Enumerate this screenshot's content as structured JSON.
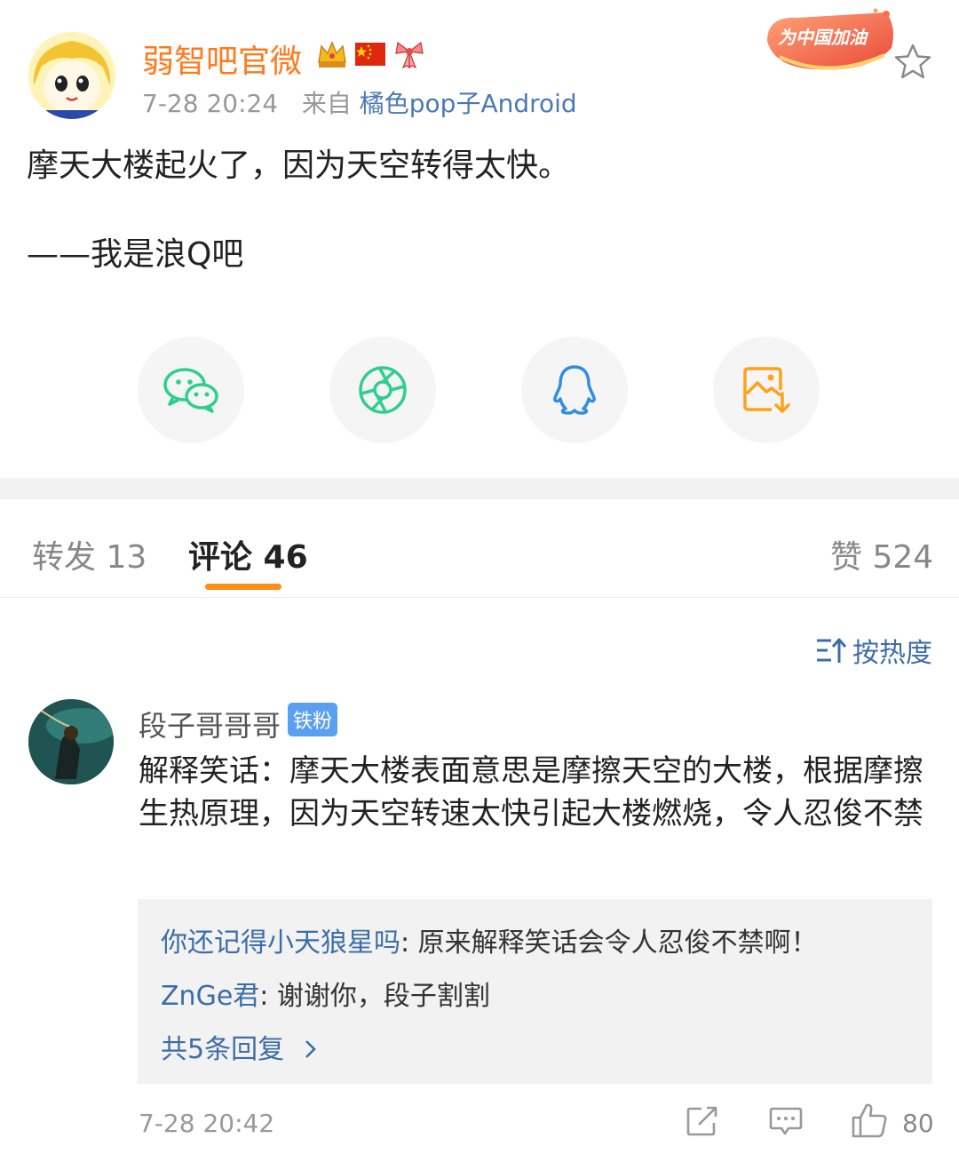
{
  "post": {
    "author": "弱智吧官微",
    "time": "7-28 20:24",
    "source_prefix": "来自",
    "source": "橘色pop子Android",
    "banner_text": "为中国加油",
    "text": "摩天大楼起火了，因为天空转得太快。\n\n——我是浪Q吧"
  },
  "share_buttons": [
    {
      "icon": "wechat-icon",
      "color": "#2ecf8c"
    },
    {
      "icon": "moments-icon",
      "color": "#2ecf8c"
    },
    {
      "icon": "qq-icon",
      "color": "#2f8de4"
    },
    {
      "icon": "save-image-icon",
      "color": "#ffa21a"
    }
  ],
  "tabs": {
    "repost": "转发 13",
    "comments": "评论 46",
    "likes": "赞 524"
  },
  "sort_label": "按热度",
  "comment": {
    "author": "段子哥哥哥",
    "badge": "铁粉",
    "text": "解释笑话：摩天大楼表面意思是摩擦天空的大楼，根据摩擦生热原理，因为天空转速太快引起大楼燃烧，令人忍俊不禁",
    "replies": [
      {
        "user": "你还记得小天狼星吗",
        "text": ": 原来解释笑话会令人忍俊不禁啊！"
      },
      {
        "user": "ZnGe君",
        "text": ": 谢谢你，段子割割"
      }
    ],
    "more_replies": "共5条回复",
    "time": "7-28 20:42",
    "likes": "80"
  }
}
